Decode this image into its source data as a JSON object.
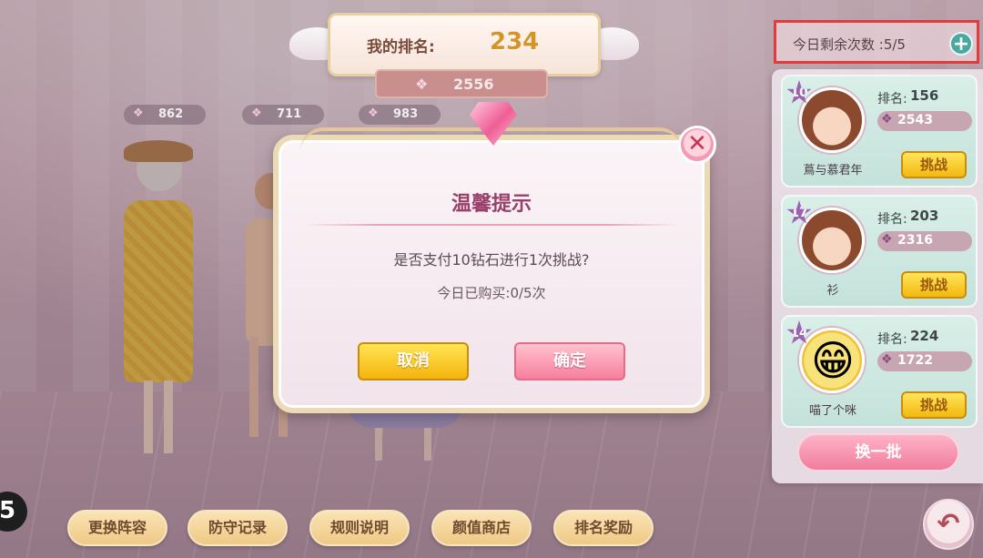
{
  "header": {
    "rank_label": "我的排名:",
    "rank_value": "234",
    "my_score": "2556"
  },
  "team_scores": [
    "862",
    "711",
    "983"
  ],
  "remaining": {
    "label": "今日剩余次数 :5/5",
    "plus_icon": "plus-circle-icon"
  },
  "opponents": [
    {
      "level": "10",
      "rank_label": "排名:",
      "rank": "156",
      "score": "2543",
      "name": "蔦与慕君年",
      "button": "挑战"
    },
    {
      "level": "17",
      "rank_label": "排名:",
      "rank": "203",
      "score": "2316",
      "name": "衫",
      "button": "挑战"
    },
    {
      "level": "14",
      "rank_label": "排名:",
      "rank": "224",
      "score": "1722",
      "name": "喵了个咪",
      "button": "挑战"
    }
  ],
  "refresh_button": "换一批",
  "bottom_nav": [
    "更换阵容",
    "防守记录",
    "规则说明",
    "颜值商店",
    "排名奖励"
  ],
  "corner_badge": "5",
  "dialog": {
    "title": "温馨提示",
    "message": "是否支付10钻石进行1次挑战?",
    "sub_message": "今日已购买:0/5次",
    "cancel": "取消",
    "confirm": "确定"
  },
  "colors": {
    "accent_pink": "#f07d9d",
    "challenge_yellow": "#f3b90f",
    "highlight_red": "#e23b3b"
  }
}
